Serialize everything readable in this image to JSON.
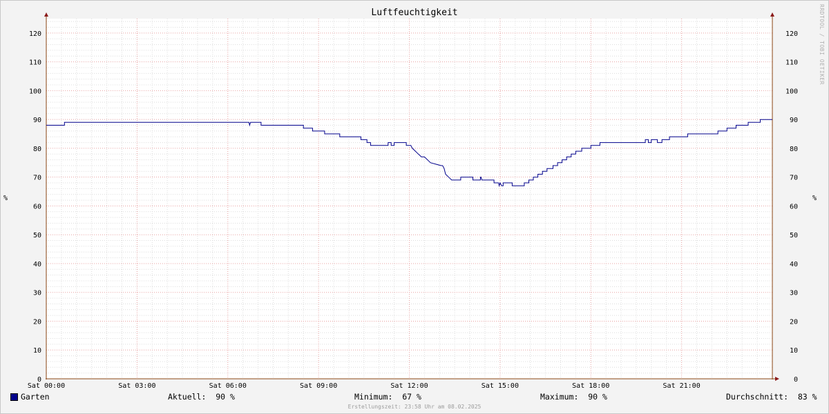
{
  "chart_data": {
    "type": "line",
    "title": "Luftfeuchtigkeit",
    "ylabel_left": "%",
    "ylabel_right": "%",
    "watermark": "RRDTOOL / TOBI OETIKER",
    "ylim": [
      0,
      125
    ],
    "yticks": [
      0,
      10,
      20,
      30,
      40,
      50,
      60,
      70,
      80,
      90,
      100,
      110,
      120
    ],
    "xlim": [
      0,
      24
    ],
    "xticks": [
      {
        "x": 0,
        "label": "Sat 00:00"
      },
      {
        "x": 3,
        "label": "Sat 03:00"
      },
      {
        "x": 6,
        "label": "Sat 06:00"
      },
      {
        "x": 9,
        "label": "Sat 09:00"
      },
      {
        "x": 12,
        "label": "Sat 12:00"
      },
      {
        "x": 15,
        "label": "Sat 15:00"
      },
      {
        "x": 18,
        "label": "Sat 18:00"
      },
      {
        "x": 21,
        "label": "Sat 21:00"
      }
    ],
    "grid": true,
    "series": [
      {
        "name": "Garten",
        "color": "#00008b",
        "x": [
          0,
          0.6,
          0.6,
          6.7,
          6.72,
          6.75,
          6.8,
          7.1,
          7.1,
          8.5,
          8.5,
          8.8,
          8.8,
          9.2,
          9.2,
          9.7,
          9.7,
          10.4,
          10.4,
          10.6,
          10.6,
          10.72,
          10.72,
          11.3,
          11.3,
          11.4,
          11.4,
          11.5,
          11.5,
          11.9,
          11.9,
          12.05,
          12.1,
          12.2,
          12.3,
          12.4,
          12.5,
          12.7,
          12.7,
          13.05,
          13.1,
          13.15,
          13.2,
          13.3,
          13.4,
          13.7,
          13.7,
          14.1,
          14.1,
          14.35,
          14.35,
          14.37,
          14.4,
          14.5,
          14.5,
          14.8,
          14.8,
          14.95,
          14.97,
          15.0,
          15.05,
          15.1,
          15.1,
          15.4,
          15.4,
          15.8,
          15.8,
          15.95,
          15.95,
          16.1,
          16.1,
          16.25,
          16.25,
          16.4,
          16.4,
          16.55,
          16.55,
          16.75,
          16.75,
          16.9,
          16.9,
          17.05,
          17.05,
          17.2,
          17.2,
          17.35,
          17.35,
          17.5,
          17.5,
          17.7,
          17.7,
          18.0,
          18.0,
          18.3,
          18.3,
          18.7,
          18.7,
          19.8,
          19.8,
          19.9,
          19.9,
          20.0,
          20.0,
          20.2,
          20.2,
          20.35,
          20.35,
          20.6,
          20.6,
          21.2,
          21.2,
          22.2,
          22.2,
          22.5,
          22.5,
          22.8,
          22.8,
          23.2,
          23.2,
          23.6,
          23.6,
          24.0
        ],
        "values": [
          88,
          88,
          89,
          89,
          88,
          89,
          89,
          89,
          88,
          88,
          87,
          87,
          86,
          86,
          85,
          85,
          84,
          84,
          83,
          83,
          82,
          82,
          81,
          81,
          82,
          82,
          81,
          81,
          82,
          82,
          81,
          81,
          80,
          79,
          78,
          77,
          77,
          75,
          75,
          74,
          74,
          73,
          71,
          70,
          69,
          69,
          70,
          70,
          69,
          69,
          70,
          70,
          69,
          69,
          69,
          69,
          68,
          68,
          67,
          68,
          67,
          67,
          68,
          68,
          67,
          67,
          68,
          68,
          69,
          69,
          70,
          70,
          71,
          71,
          72,
          72,
          73,
          73,
          74,
          74,
          75,
          75,
          76,
          76,
          77,
          77,
          78,
          78,
          79,
          79,
          80,
          80,
          81,
          81,
          82,
          82,
          82,
          82,
          83,
          83,
          82,
          82,
          83,
          83,
          82,
          82,
          83,
          83,
          84,
          84,
          85,
          85,
          86,
          86,
          87,
          87,
          88,
          88,
          89,
          89,
          90,
          90
        ]
      }
    ]
  },
  "legend": {
    "series_name": "Garten",
    "current": "Aktuell:  90 %",
    "minimum": "Minimum:  67 %",
    "maximum": "Maximum:  90 %",
    "average": "Durchschnitt:  83 %"
  },
  "footer": "Erstellungszeit: 23:58 Uhr am 08.02.2025"
}
